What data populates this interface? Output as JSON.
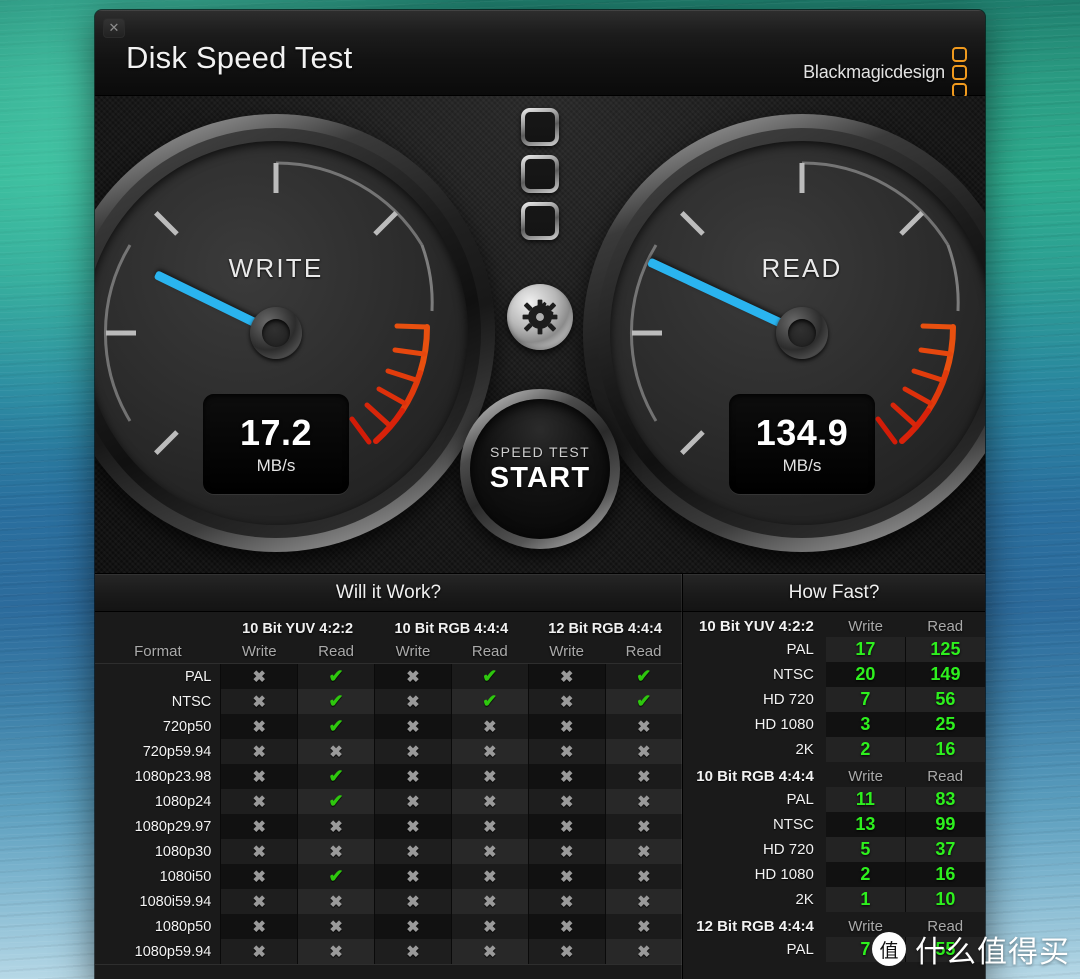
{
  "window": {
    "title": "Disk Speed Test",
    "close_label": "✕",
    "brand": "Blackmagicdesign"
  },
  "gauges": {
    "write": {
      "label": "WRITE",
      "value": "17.2",
      "unit": "MB/s",
      "needle_deg": 206
    },
    "read": {
      "label": "READ",
      "value": "134.9",
      "unit": "MB/s",
      "needle_deg": 205
    }
  },
  "center": {
    "chips": [
      "chip-1",
      "chip-2",
      "chip-3"
    ],
    "gear_label": "gear-icon",
    "start_sub": "SPEED TEST",
    "start_main": "START"
  },
  "will_it_work": {
    "title": "Will it Work?",
    "groups": [
      "10 Bit YUV 4:2:2",
      "10 Bit RGB 4:4:4",
      "12 Bit RGB 4:4:4"
    ],
    "format_header": "Format",
    "sub_headers": [
      "Write",
      "Read",
      "Write",
      "Read",
      "Write",
      "Read"
    ],
    "ok_mark": "✔",
    "no_mark": "✖",
    "rows": [
      {
        "format": "PAL",
        "cells": [
          false,
          true,
          false,
          true,
          false,
          true
        ]
      },
      {
        "format": "NTSC",
        "cells": [
          false,
          true,
          false,
          true,
          false,
          true
        ]
      },
      {
        "format": "720p50",
        "cells": [
          false,
          true,
          false,
          false,
          false,
          false
        ]
      },
      {
        "format": "720p59.94",
        "cells": [
          false,
          false,
          false,
          false,
          false,
          false
        ]
      },
      {
        "format": "1080p23.98",
        "cells": [
          false,
          true,
          false,
          false,
          false,
          false
        ]
      },
      {
        "format": "1080p24",
        "cells": [
          false,
          true,
          false,
          false,
          false,
          false
        ]
      },
      {
        "format": "1080p29.97",
        "cells": [
          false,
          false,
          false,
          false,
          false,
          false
        ]
      },
      {
        "format": "1080p30",
        "cells": [
          false,
          false,
          false,
          false,
          false,
          false
        ]
      },
      {
        "format": "1080i50",
        "cells": [
          false,
          true,
          false,
          false,
          false,
          false
        ]
      },
      {
        "format": "1080i59.94",
        "cells": [
          false,
          false,
          false,
          false,
          false,
          false
        ]
      },
      {
        "format": "1080p50",
        "cells": [
          false,
          false,
          false,
          false,
          false,
          false
        ]
      },
      {
        "format": "1080p59.94",
        "cells": [
          false,
          false,
          false,
          false,
          false,
          false
        ]
      }
    ]
  },
  "how_fast": {
    "title": "How Fast?",
    "write_header": "Write",
    "read_header": "Read",
    "sections": [
      {
        "name": "10 Bit YUV 4:2:2",
        "rows": [
          {
            "label": "PAL",
            "write": "17",
            "read": "125"
          },
          {
            "label": "NTSC",
            "write": "20",
            "read": "149"
          },
          {
            "label": "HD 720",
            "write": "7",
            "read": "56"
          },
          {
            "label": "HD 1080",
            "write": "3",
            "read": "25"
          },
          {
            "label": "2K",
            "write": "2",
            "read": "16"
          }
        ]
      },
      {
        "name": "10 Bit RGB 4:4:4",
        "rows": [
          {
            "label": "PAL",
            "write": "11",
            "read": "83"
          },
          {
            "label": "NTSC",
            "write": "13",
            "read": "99"
          },
          {
            "label": "HD 720",
            "write": "5",
            "read": "37"
          },
          {
            "label": "HD 1080",
            "write": "2",
            "read": "16"
          },
          {
            "label": "2K",
            "write": "1",
            "read": "10"
          }
        ]
      },
      {
        "name": "12 Bit RGB 4:4:4",
        "rows": [
          {
            "label": "PAL",
            "write": "7",
            "read": "55"
          }
        ]
      }
    ]
  },
  "watermark": {
    "badge": "值",
    "text": "什么值得买"
  }
}
